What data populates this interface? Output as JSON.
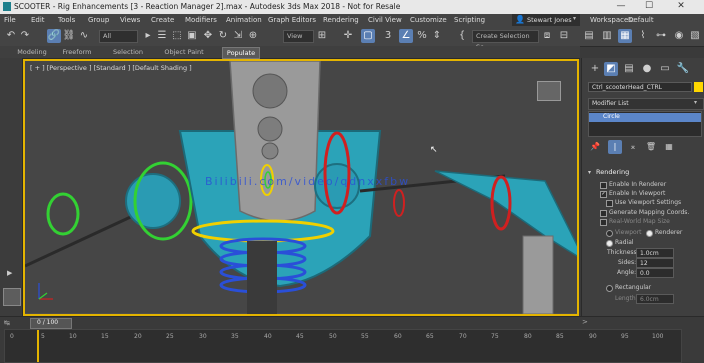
{
  "window": {
    "title": "SCOOTER - Rig Enhancements [3 - Reaction Manager 2].max - Autodesk 3ds Max 2018 - Not for Resale",
    "controls": [
      "—",
      "☐",
      "✕"
    ]
  },
  "menu": {
    "items": [
      "File",
      "Edit",
      "Tools",
      "Group",
      "Views",
      "Create",
      "Modifiers",
      "Animation",
      "Graph Editors",
      "Rendering",
      "Civil View",
      "Customize",
      "Scripting"
    ],
    "user": "Stewart Jones",
    "workspaces_label": "Workspaces:",
    "workspaces_value": "Default"
  },
  "toolbar": {
    "filter_value": "All",
    "view_value": "View",
    "selection_set_placeholder": "Create Selection Se"
  },
  "ribbon": {
    "tabs": [
      "Modeling",
      "Freeform",
      "Selection",
      "Object Paint",
      "Populate"
    ],
    "active_tab": "Populate"
  },
  "viewport": {
    "label": "[ + ] [Perspective ] [Standard ] [Default Shading ]",
    "watermark": "Bilibili.com/video/qdnxxfbw"
  },
  "command_panel": {
    "object_name": "Ctrl_scooterHead_CTRL",
    "object_color": "#ffd700",
    "modifier_list_label": "Modifier List",
    "stack_item": "Circle",
    "rollout_title": "Rendering",
    "enable_in_renderer": "Enable In Renderer",
    "enable_in_viewport": "Enable In Viewport",
    "use_viewport_settings": "Use Viewport Settings",
    "generate_mapping": "Generate Mapping Coords.",
    "real_world_map_size": "Real-World Map Size",
    "viewport_option": "Viewport",
    "renderer_option": "Renderer",
    "radial_label": "Radial",
    "thickness_label": "Thickness:",
    "thickness_value": "1.0cm",
    "sides_label": "Sides:",
    "sides_value": "12",
    "angle_label": "Angle:",
    "angle_value": "0.0",
    "rectangular_label": "Rectangular",
    "length_label": "Length:",
    "length_value": "6.0cm"
  },
  "timeline": {
    "frame_display": "0 / 100",
    "ticks": [
      "0",
      "5",
      "10",
      "15",
      "20",
      "25",
      "30",
      "35",
      "40",
      "45",
      "50",
      "55",
      "60",
      "65",
      "70",
      "75",
      "80",
      "85",
      "90",
      "95",
      "100"
    ]
  }
}
